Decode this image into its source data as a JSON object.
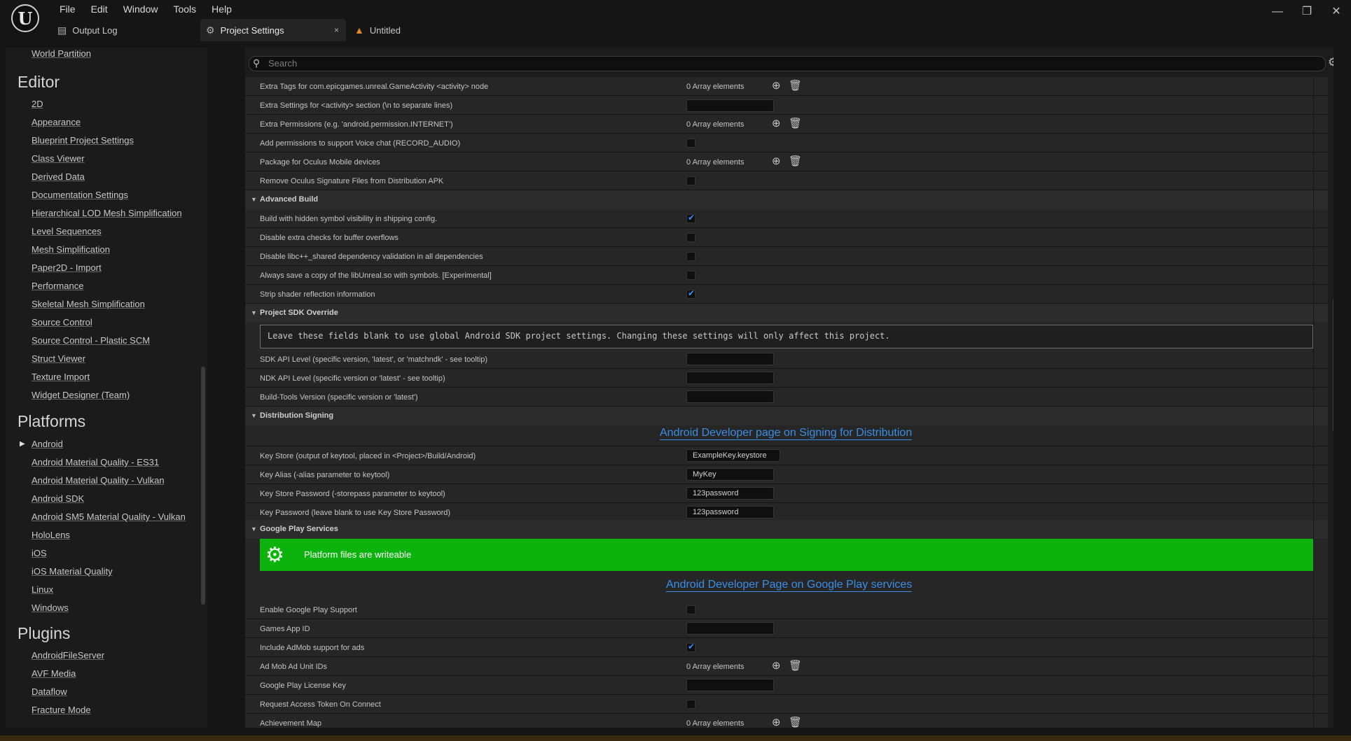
{
  "app": {
    "logo_glyph": "U",
    "menu": [
      "File",
      "Edit",
      "Window",
      "Tools",
      "Help"
    ],
    "window_controls": {
      "minimize": "—",
      "restore": "❐",
      "close": "✕"
    },
    "tabs": [
      {
        "label": "Output Log",
        "icon": "output-log-icon"
      },
      {
        "label": "Project Settings",
        "icon": "project-settings-icon",
        "close": "×"
      },
      {
        "label": "Untitled",
        "icon": "level-icon"
      }
    ]
  },
  "sidebar": {
    "top_item": "World Partition",
    "sections": [
      {
        "title": "Editor",
        "items": [
          "2D",
          "Appearance",
          "Blueprint Project Settings",
          "Class Viewer",
          "Derived Data",
          "Documentation Settings",
          "Hierarchical LOD Mesh Simplification",
          "Level Sequences",
          "Mesh Simplification",
          "Paper2D - Import",
          "Performance",
          "Skeletal Mesh Simplification",
          "Source Control",
          "Source Control - Plastic SCM",
          "Struct Viewer",
          "Texture Import",
          "Widget Designer (Team)"
        ]
      },
      {
        "title": "Platforms",
        "items": [
          "Android",
          "Android Material Quality - ES31",
          "Android Material Quality - Vulkan",
          "Android SDK",
          "Android SM5 Material Quality - Vulkan",
          "HoloLens",
          "iOS",
          "iOS Material Quality",
          "Linux",
          "Windows"
        ]
      },
      {
        "title": "Plugins",
        "items": [
          "AndroidFileServer",
          "AVF Media",
          "Dataflow",
          "Fracture Mode"
        ]
      }
    ]
  },
  "details": {
    "search_placeholder": "Search",
    "rows": {
      "extra_tags": {
        "label": "Extra Tags for com.epicgames.unreal.GameActivity <activity> node",
        "value": "0 Array elements"
      },
      "extra_settings": {
        "label": "Extra Settings for <activity> section (\\n to separate lines)",
        "value": ""
      },
      "extra_permissions": {
        "label": "Extra Permissions (e.g. 'android.permission.INTERNET')",
        "value": "0 Array elements"
      },
      "voice_chat": {
        "label": "Add permissions to support Voice chat (RECORD_AUDIO)"
      },
      "oculus_package": {
        "label": "Package for Oculus Mobile devices",
        "value": "0 Array elements"
      },
      "remove_oculus_sig": {
        "label": "Remove Oculus Signature Files from Distribution APK"
      },
      "hidden_symbol": {
        "label": "Build with hidden symbol visibility in shipping config."
      },
      "buffer_overflow": {
        "label": "Disable extra checks for buffer overflows"
      },
      "libcpp_validation": {
        "label": "Disable libc++_shared dependency validation in all dependencies"
      },
      "save_libunreal": {
        "label": "Always save a copy of the libUnreal.so with symbols. [Experimental]"
      },
      "strip_shader": {
        "label": "Strip shader reflection information"
      },
      "sdk_api": {
        "label": "SDK API Level (specific version, 'latest', or 'matchndk' - see tooltip)",
        "value": ""
      },
      "ndk_api": {
        "label": "NDK API Level (specific version or 'latest' - see tooltip)",
        "value": ""
      },
      "build_tools": {
        "label": "Build-Tools Version (specific version or 'latest')",
        "value": ""
      },
      "key_store": {
        "label": "Key Store (output of keytool, placed in <Project>/Build/Android)",
        "value": "ExampleKey.keystore"
      },
      "key_alias": {
        "label": "Key Alias (-alias parameter to keytool)",
        "value": "MyKey"
      },
      "key_store_password": {
        "label": "Key Store Password (-storepass parameter to keytool)",
        "value": "123password"
      },
      "key_password": {
        "label": "Key Password (leave blank to use Key Store Password)",
        "value": "123password"
      },
      "enable_gps": {
        "label": "Enable Google Play Support"
      },
      "games_app_id": {
        "label": "Games App ID",
        "value": ""
      },
      "admob": {
        "label": "Include AdMob support for ads"
      },
      "admob_ids": {
        "label": "Ad Mob Ad Unit IDs",
        "value": "0 Array elements"
      },
      "license_key": {
        "label": "Google Play License Key",
        "value": ""
      },
      "access_token": {
        "label": "Request Access Token On Connect"
      },
      "achievement_map": {
        "label": "Achievement Map",
        "value": "0 Array elements"
      }
    },
    "checkbox_states": {
      "voice_chat": false,
      "remove_oculus_sig": false,
      "hidden_symbol": true,
      "buffer_overflow": false,
      "libcpp_validation": false,
      "save_libunreal": false,
      "strip_shader": true,
      "enable_gps": false,
      "admob": true,
      "access_token": false
    },
    "categories": {
      "advanced_build": "Advanced Build",
      "sdk_override": "Project SDK Override",
      "distribution_signing": "Distribution Signing",
      "google_play": "Google Play Services"
    },
    "sdk_note": "Leave these fields blank to use global Android SDK project settings. Changing these settings will only affect this project.",
    "signing_link": "Android Developer page on Signing for Distribution",
    "platform_files_status": "Platform files are writeable",
    "play_services_link": "Android Developer Page on Google Play services"
  },
  "colors": {
    "accent": "#3a8ee6",
    "writeable_banner": "#0db30d",
    "checkbox_check": "#3d8bff"
  }
}
